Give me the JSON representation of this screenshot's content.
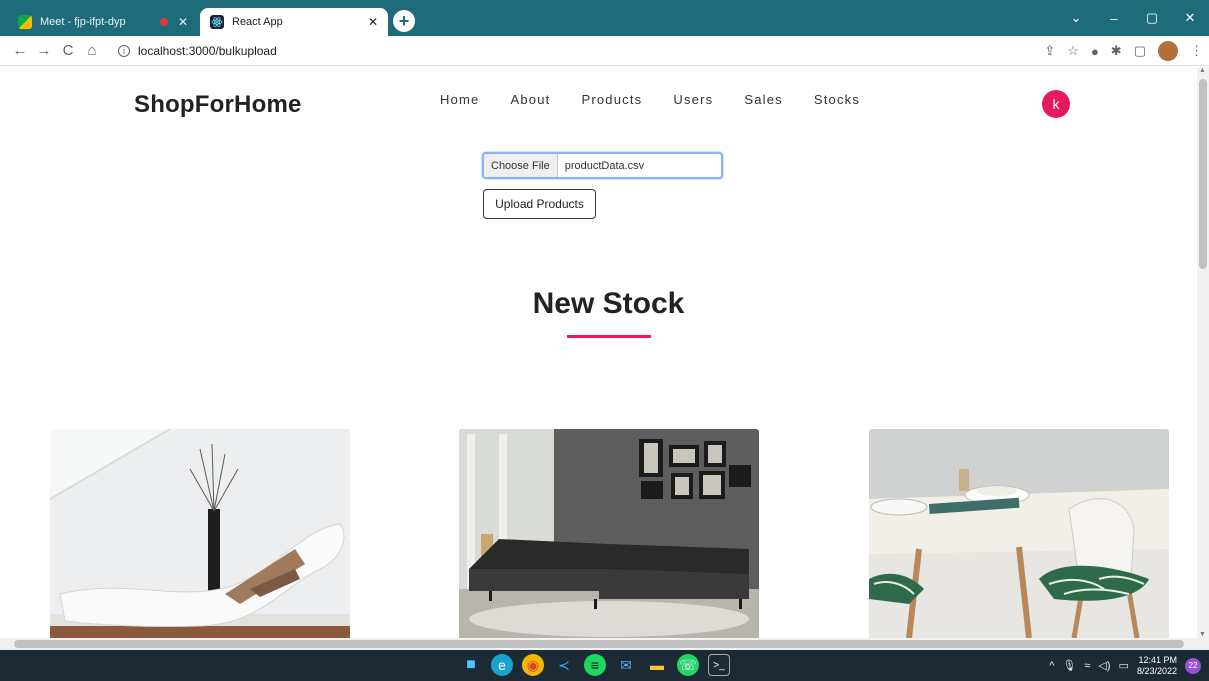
{
  "browser": {
    "tabs": [
      {
        "title": "Meet - fjp-ifpt-dyp",
        "active": false,
        "recording": true
      },
      {
        "title": "React App",
        "active": true,
        "recording": false
      }
    ],
    "new_tab_glyph": "+",
    "window_controls": [
      "⌄",
      "–",
      "▢",
      "✕"
    ],
    "url": "localhost:3000/bulkupload",
    "nav_glyphs": {
      "back": "←",
      "forward": "→",
      "reload": "C",
      "home": "⌂"
    },
    "toolbar_icons": [
      "share-icon",
      "star-icon",
      "extension-icon",
      "puzzle-icon",
      "sidepanel-icon",
      "profile-icon",
      "menu-icon"
    ]
  },
  "site": {
    "brand": "ShopForHome",
    "nav": [
      "Home",
      "About",
      "Products",
      "Users",
      "Sales",
      "Stocks"
    ],
    "user_initial": "k",
    "accent_color": "#e8185c"
  },
  "upload": {
    "choose_file_label": "Choose File",
    "file_name": "productData.csv",
    "upload_button": "Upload Products"
  },
  "section": {
    "title": "New Stock"
  },
  "products": [
    {
      "image": "white-chaise-lounge"
    },
    {
      "image": "dark-sectional-sofa"
    },
    {
      "image": "dining-table-chairs"
    }
  ],
  "taskbar": {
    "apps": [
      "windows-start-icon",
      "edge-icon",
      "chrome-icon",
      "vscode-icon",
      "spotify-icon",
      "mail-icon",
      "file-explorer-icon",
      "whatsapp-icon",
      "terminal-icon"
    ],
    "time": "12:41 PM",
    "date": "8/23/2022",
    "notifications": "22"
  }
}
